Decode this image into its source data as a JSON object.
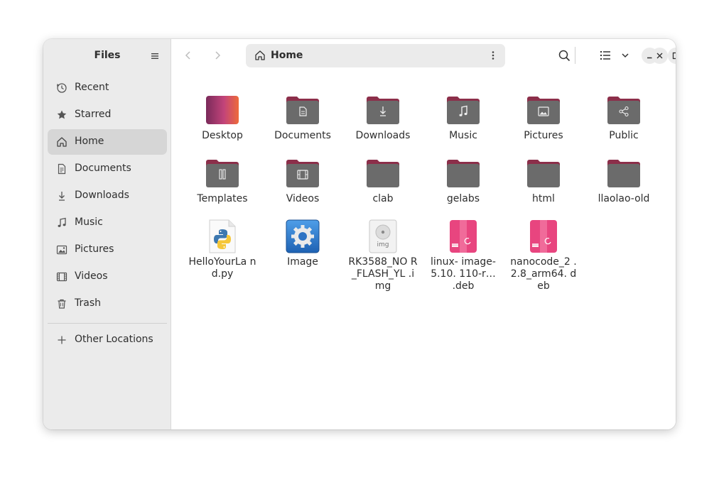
{
  "sidebar": {
    "title": "Files",
    "items": [
      {
        "label": "Recent",
        "icon": "clock-icon"
      },
      {
        "label": "Starred",
        "icon": "star-icon"
      },
      {
        "label": "Home",
        "icon": "home-icon",
        "active": true
      },
      {
        "label": "Documents",
        "icon": "document-icon"
      },
      {
        "label": "Downloads",
        "icon": "download-icon"
      },
      {
        "label": "Music",
        "icon": "music-note-icon"
      },
      {
        "label": "Pictures",
        "icon": "image-icon"
      },
      {
        "label": "Videos",
        "icon": "film-icon"
      },
      {
        "label": "Trash",
        "icon": "trash-icon"
      }
    ],
    "other_locations": "Other Locations"
  },
  "toolbar": {
    "path": "Home"
  },
  "files": [
    {
      "name": "Desktop",
      "type": "desktop-folder"
    },
    {
      "name": "Documents",
      "type": "folder",
      "emblem": "document"
    },
    {
      "name": "Downloads",
      "type": "folder",
      "emblem": "download"
    },
    {
      "name": "Music",
      "type": "folder",
      "emblem": "music"
    },
    {
      "name": "Pictures",
      "type": "folder",
      "emblem": "picture"
    },
    {
      "name": "Public",
      "type": "folder",
      "emblem": "share"
    },
    {
      "name": "Templates",
      "type": "folder",
      "emblem": "template"
    },
    {
      "name": "Videos",
      "type": "folder",
      "emblem": "video"
    },
    {
      "name": "clab",
      "type": "folder"
    },
    {
      "name": "gelabs",
      "type": "folder"
    },
    {
      "name": "html",
      "type": "folder"
    },
    {
      "name": "llaolao-old",
      "type": "folder"
    },
    {
      "name": "HelloYourLa nd.py",
      "type": "python"
    },
    {
      "name": "Image",
      "type": "settings"
    },
    {
      "name": "RK3588_NO R_FLASH_YL .img",
      "type": "disk-image",
      "badge": "img"
    },
    {
      "name": "linux- image-5.10. 110-r… .deb",
      "type": "deb"
    },
    {
      "name": "nanocode_2 .2.8_arm64. deb",
      "type": "deb"
    }
  ],
  "colors": {
    "folder_body": "#6b6b6b",
    "folder_tab": "#8c2f4a",
    "deb_pink": "#e8457f",
    "sidebar_bg": "#ebebeb",
    "active_bg": "#d6d6d6"
  }
}
